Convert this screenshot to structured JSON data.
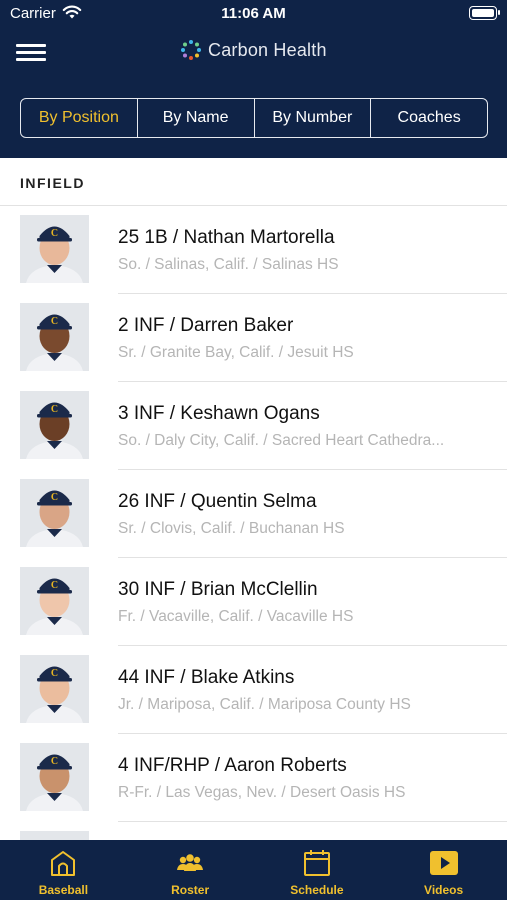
{
  "status_bar": {
    "carrier": "Carrier",
    "time": "11:06 AM"
  },
  "header": {
    "brand_name": "Carbon Health",
    "segments": [
      {
        "label": "By Position",
        "active": true
      },
      {
        "label": "By Name",
        "active": false
      },
      {
        "label": "By Number",
        "active": false
      },
      {
        "label": "Coaches",
        "active": false
      }
    ]
  },
  "section": {
    "title": "INFIELD"
  },
  "players": [
    {
      "title": "25 1B / Nathan Martorella",
      "subtitle": "So. / Salinas, Calif. / Salinas HS"
    },
    {
      "title": "2 INF / Darren Baker",
      "subtitle": "Sr. / Granite Bay, Calif. / Jesuit HS"
    },
    {
      "title": "3 INF / Keshawn Ogans",
      "subtitle": "So. / Daly City, Calif. / Sacred Heart Cathedra..."
    },
    {
      "title": "26 INF / Quentin Selma",
      "subtitle": "Sr. / Clovis, Calif. / Buchanan HS"
    },
    {
      "title": "30 INF / Brian McClellin",
      "subtitle": "Fr. / Vacaville, Calif. / Vacaville HS"
    },
    {
      "title": "44 INF / Blake Atkins",
      "subtitle": "Jr. / Mariposa, Calif. / Mariposa County HS"
    },
    {
      "title": "4 INF/RHP / Aaron Roberts",
      "subtitle": "R-Fr. / Las Vegas, Nev. / Desert Oasis HS"
    }
  ],
  "tabbar": {
    "tabs": [
      {
        "label": "Baseball",
        "icon": "stadium-icon"
      },
      {
        "label": "Roster",
        "icon": "roster-icon"
      },
      {
        "label": "Schedule",
        "icon": "calendar-icon"
      },
      {
        "label": "Videos",
        "icon": "play-icon"
      }
    ]
  },
  "colors": {
    "navy": "#0f2347",
    "gold": "#f0c02e",
    "subtitle_gray": "#b5b5b5"
  }
}
